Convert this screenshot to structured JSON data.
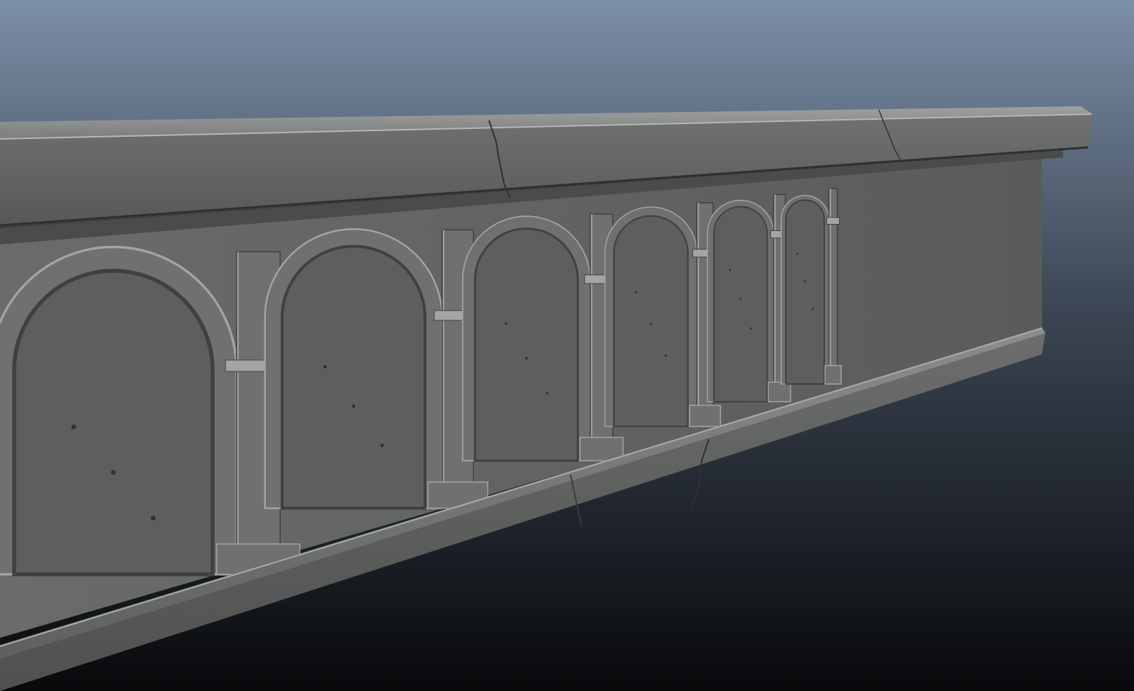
{
  "scene": {
    "subject": "sculpted-stone-arcade-wall",
    "background": {
      "top_color": "#7b8fa6",
      "bottom_color": "#08090b"
    },
    "stone": {
      "base_color": "#6f7170",
      "light_color": "#a3a5a4",
      "shadow_color": "#3f4140",
      "recess_color": "#5d5f5e",
      "crack_color": "#2f3130"
    },
    "arch_count": 6
  }
}
